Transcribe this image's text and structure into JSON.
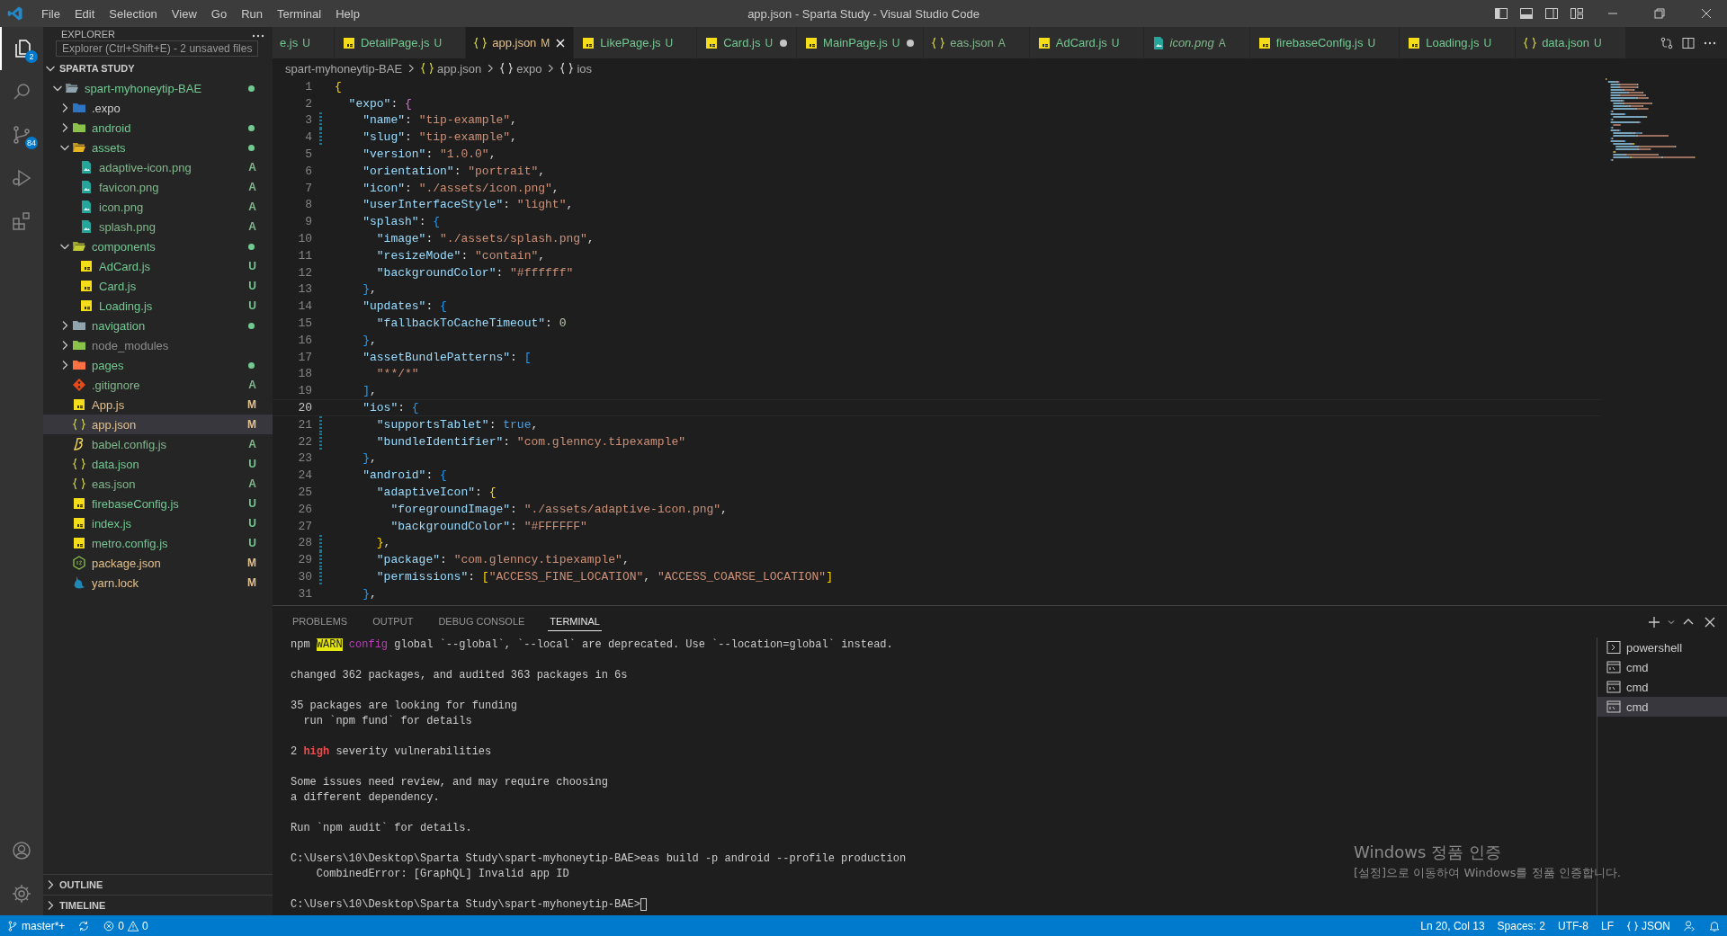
{
  "window": {
    "title": "app.json - Sparta Study - Visual Studio Code"
  },
  "menu": [
    "File",
    "Edit",
    "Selection",
    "View",
    "Go",
    "Run",
    "Terminal",
    "Help"
  ],
  "activity_bar": {
    "top": [
      {
        "badge": "2",
        "selected": true
      },
      {
        "selected": false
      },
      {
        "badge": "84",
        "selected": false
      },
      {
        "selected": false
      },
      {
        "selected": false
      }
    ],
    "bottom": [
      {
        "selected": false
      },
      {
        "selected": false
      }
    ]
  },
  "explorer": {
    "title": "EXPLORER",
    "tooltip": "Explorer (Ctrl+Shift+E) - 2 unsaved files",
    "workspace": "SPARTA STUDY",
    "tree": [
      {
        "kind": "folder",
        "name": "spart-myhoneytip-BAE",
        "color": "#73c991",
        "dot": true,
        "expanded": true,
        "selected": false,
        "children": [
          {
            "kind": "expo-folder",
            "name": ".expo",
            "color": "#cccccc",
            "dot": false,
            "expanded": false,
            "selected": false
          },
          {
            "kind": "android-folder",
            "name": "android",
            "color": "#73c991",
            "dot": true,
            "expanded": false,
            "selected": false
          },
          {
            "kind": "assets-folder",
            "name": "assets",
            "color": "#73c991",
            "dot": true,
            "expanded": true,
            "selected": false,
            "children": [
              {
                "kind": "image",
                "name": "adaptive-icon.png",
                "badge": "A",
                "color": "#81b88b",
                "dot": false,
                "selected": false
              },
              {
                "kind": "image",
                "name": "favicon.png",
                "badge": "A",
                "color": "#81b88b",
                "dot": false,
                "selected": false
              },
              {
                "kind": "image",
                "name": "icon.png",
                "badge": "A",
                "color": "#81b88b",
                "dot": false,
                "selected": false
              },
              {
                "kind": "image",
                "name": "splash.png",
                "badge": "A",
                "color": "#81b88b",
                "dot": false,
                "selected": false
              }
            ]
          },
          {
            "kind": "components-folder",
            "name": "components",
            "color": "#73c991",
            "dot": true,
            "expanded": true,
            "selected": false,
            "children": [
              {
                "kind": "js",
                "name": "AdCard.js",
                "badge": "U",
                "color": "#73c991",
                "dot": false,
                "selected": false
              },
              {
                "kind": "js",
                "name": "Card.js",
                "badge": "U",
                "color": "#73c991",
                "dot": false,
                "selected": false
              },
              {
                "kind": "js",
                "name": "Loading.js",
                "badge": "U",
                "color": "#73c991",
                "dot": false,
                "selected": false
              }
            ]
          },
          {
            "kind": "folder",
            "name": "navigation",
            "color": "#73c991",
            "dot": true,
            "expanded": false,
            "selected": false
          },
          {
            "kind": "node-folder",
            "name": "node_modules",
            "color": "#8c8c8c",
            "dot": false,
            "expanded": false,
            "selected": false
          },
          {
            "kind": "pages-folder",
            "name": "pages",
            "color": "#73c991",
            "dot": true,
            "expanded": false,
            "selected": false
          },
          {
            "kind": "git",
            "name": ".gitignore",
            "badge": "A",
            "color": "#81b88b",
            "dot": false,
            "selected": false
          },
          {
            "kind": "js",
            "name": "App.js",
            "badge": "M",
            "color": "#e2c08d",
            "dot": false,
            "selected": false
          },
          {
            "kind": "json",
            "name": "app.json",
            "badge": "M",
            "color": "#e2c08d",
            "dot": false,
            "selected": true
          },
          {
            "kind": "babel",
            "name": "babel.config.js",
            "badge": "A",
            "color": "#81b88b",
            "dot": false,
            "selected": false
          },
          {
            "kind": "json",
            "name": "data.json",
            "badge": "U",
            "color": "#73c991",
            "dot": false,
            "selected": false
          },
          {
            "kind": "json",
            "name": "eas.json",
            "badge": "A",
            "color": "#81b88b",
            "dot": false,
            "selected": false
          },
          {
            "kind": "js",
            "name": "firebaseConfig.js",
            "badge": "U",
            "color": "#73c991",
            "dot": false,
            "selected": false
          },
          {
            "kind": "js",
            "name": "index.js",
            "badge": "U",
            "color": "#73c991",
            "dot": false,
            "selected": false
          },
          {
            "kind": "js",
            "name": "metro.config.js",
            "badge": "U",
            "color": "#73c991",
            "dot": false,
            "selected": false
          },
          {
            "kind": "node",
            "name": "package.json",
            "badge": "M",
            "color": "#e2c08d",
            "dot": false,
            "selected": false
          },
          {
            "kind": "yarn",
            "name": "yarn.lock",
            "badge": "M",
            "color": "#e2c08d",
            "dot": false,
            "selected": false
          }
        ]
      }
    ],
    "sections": [
      {
        "title": "OUTLINE",
        "expanded": false
      },
      {
        "title": "TIMELINE",
        "expanded": false
      }
    ]
  },
  "tabs": [
    {
      "label": "e.js",
      "status": "U",
      "color": "#73c991",
      "dirty": false,
      "selected": false,
      "preview": false
    },
    {
      "kind": "js",
      "label": "DetailPage.js",
      "status": "U",
      "color": "#73c991",
      "dirty": false,
      "selected": false,
      "preview": false
    },
    {
      "kind": "json",
      "label": "app.json",
      "status": "M",
      "color": "#e2c08d",
      "dirty": false,
      "selected": true,
      "preview": false
    },
    {
      "kind": "js",
      "label": "LikePage.js",
      "status": "U",
      "color": "#73c991",
      "dirty": false,
      "selected": false,
      "preview": false
    },
    {
      "kind": "js",
      "label": "Card.js",
      "status": "U",
      "color": "#73c991",
      "dirty": true,
      "selected": false,
      "preview": false
    },
    {
      "kind": "js",
      "label": "MainPage.js",
      "status": "U",
      "color": "#73c991",
      "dirty": true,
      "selected": false,
      "preview": false
    },
    {
      "kind": "json",
      "label": "eas.json",
      "status": "A",
      "color": "#81b88b",
      "dirty": false,
      "selected": false,
      "preview": false
    },
    {
      "kind": "js",
      "label": "AdCard.js",
      "status": "U",
      "color": "#73c991",
      "dirty": false,
      "selected": false,
      "preview": false
    },
    {
      "kind": "image",
      "label": "icon.png",
      "status": "A",
      "color": "#81b88b",
      "dirty": false,
      "selected": false,
      "preview": true
    },
    {
      "kind": "js",
      "label": "firebaseConfig.js",
      "status": "U",
      "color": "#73c991",
      "dirty": false,
      "selected": false,
      "preview": false
    },
    {
      "kind": "js",
      "label": "Loading.js",
      "status": "U",
      "color": "#73c991",
      "dirty": false,
      "selected": false,
      "preview": false
    },
    {
      "kind": "json",
      "label": "data.json",
      "status": "U",
      "color": "#73c991",
      "dirty": false,
      "selected": false,
      "preview": false
    }
  ],
  "breadcrumb": [
    {
      "text": "spart-myhoneytip-BAE"
    },
    {
      "kind": "json",
      "text": "app.json"
    },
    {
      "kind": "object",
      "text": "expo"
    },
    {
      "kind": "object",
      "text": "ios"
    }
  ],
  "editor": {
    "lines": [
      {
        "number": "1",
        "current": false,
        "changed": false,
        "tokens": [
          {
            "kind": "b1",
            "text": "{"
          }
        ]
      },
      {
        "number": "2",
        "current": false,
        "changed": false,
        "tokens": [
          {
            "kind": "key",
            "text": "  \"expo\""
          },
          {
            "kind": "punct",
            "text": ": "
          },
          {
            "kind": "b2",
            "text": "{"
          }
        ]
      },
      {
        "number": "3",
        "current": false,
        "changed": true,
        "tokens": [
          {
            "kind": "key",
            "text": "    \"name\""
          },
          {
            "kind": "punct",
            "text": ": "
          },
          {
            "kind": "string",
            "text": "\"tip-example\""
          },
          {
            "kind": "punct",
            "text": ","
          }
        ]
      },
      {
        "number": "4",
        "current": false,
        "changed": true,
        "tokens": [
          {
            "kind": "key",
            "text": "    \"slug\""
          },
          {
            "kind": "punct",
            "text": ": "
          },
          {
            "kind": "string",
            "text": "\"tip-example\""
          },
          {
            "kind": "punct",
            "text": ","
          }
        ]
      },
      {
        "number": "5",
        "current": false,
        "changed": false,
        "tokens": [
          {
            "kind": "key",
            "text": "    \"version\""
          },
          {
            "kind": "punct",
            "text": ": "
          },
          {
            "kind": "string",
            "text": "\"1.0.0\""
          },
          {
            "kind": "punct",
            "text": ","
          }
        ]
      },
      {
        "number": "6",
        "current": false,
        "changed": false,
        "tokens": [
          {
            "kind": "key",
            "text": "    \"orientation\""
          },
          {
            "kind": "punct",
            "text": ": "
          },
          {
            "kind": "string",
            "text": "\"portrait\""
          },
          {
            "kind": "punct",
            "text": ","
          }
        ]
      },
      {
        "number": "7",
        "current": false,
        "changed": false,
        "tokens": [
          {
            "kind": "key",
            "text": "    \"icon\""
          },
          {
            "kind": "punct",
            "text": ": "
          },
          {
            "kind": "string",
            "text": "\"./assets/icon.png\""
          },
          {
            "kind": "punct",
            "text": ","
          }
        ]
      },
      {
        "number": "8",
        "current": false,
        "changed": false,
        "tokens": [
          {
            "kind": "key",
            "text": "    \"userInterfaceStyle\""
          },
          {
            "kind": "punct",
            "text": ": "
          },
          {
            "kind": "string",
            "text": "\"light\""
          },
          {
            "kind": "punct",
            "text": ","
          }
        ]
      },
      {
        "number": "9",
        "current": false,
        "changed": false,
        "tokens": [
          {
            "kind": "key",
            "text": "    \"splash\""
          },
          {
            "kind": "punct",
            "text": ": "
          },
          {
            "kind": "b3",
            "text": "{"
          }
        ]
      },
      {
        "number": "10",
        "current": false,
        "changed": false,
        "tokens": [
          {
            "kind": "key",
            "text": "      \"image\""
          },
          {
            "kind": "punct",
            "text": ": "
          },
          {
            "kind": "string",
            "text": "\"./assets/splash.png\""
          },
          {
            "kind": "punct",
            "text": ","
          }
        ]
      },
      {
        "number": "11",
        "current": false,
        "changed": false,
        "tokens": [
          {
            "kind": "key",
            "text": "      \"resizeMode\""
          },
          {
            "kind": "punct",
            "text": ": "
          },
          {
            "kind": "string",
            "text": "\"contain\""
          },
          {
            "kind": "punct",
            "text": ","
          }
        ]
      },
      {
        "number": "12",
        "current": false,
        "changed": false,
        "tokens": [
          {
            "kind": "key",
            "text": "      \"backgroundColor\""
          },
          {
            "kind": "punct",
            "text": ": "
          },
          {
            "kind": "string",
            "text": "\"#ffffff\""
          }
        ]
      },
      {
        "number": "13",
        "current": false,
        "changed": false,
        "tokens": [
          {
            "kind": "b3",
            "text": "    }"
          },
          {
            "kind": "punct",
            "text": ","
          }
        ]
      },
      {
        "number": "14",
        "current": false,
        "changed": false,
        "tokens": [
          {
            "kind": "key",
            "text": "    \"updates\""
          },
          {
            "kind": "punct",
            "text": ": "
          },
          {
            "kind": "b3",
            "text": "{"
          }
        ]
      },
      {
        "number": "15",
        "current": false,
        "changed": false,
        "tokens": [
          {
            "kind": "key",
            "text": "      \"fallbackToCacheTimeout\""
          },
          {
            "kind": "punct",
            "text": ": "
          },
          {
            "kind": "number",
            "text": "0"
          }
        ]
      },
      {
        "number": "16",
        "current": false,
        "changed": false,
        "tokens": [
          {
            "kind": "b3",
            "text": "    }"
          },
          {
            "kind": "punct",
            "text": ","
          }
        ]
      },
      {
        "number": "17",
        "current": false,
        "changed": false,
        "tokens": [
          {
            "kind": "key",
            "text": "    \"assetBundlePatterns\""
          },
          {
            "kind": "punct",
            "text": ": "
          },
          {
            "kind": "b3",
            "text": "["
          }
        ]
      },
      {
        "number": "18",
        "current": false,
        "changed": false,
        "tokens": [
          {
            "kind": "string",
            "text": "      \"**/*\""
          }
        ]
      },
      {
        "number": "19",
        "current": false,
        "changed": false,
        "tokens": [
          {
            "kind": "b3",
            "text": "    ]"
          },
          {
            "kind": "punct",
            "text": ","
          }
        ]
      },
      {
        "number": "20",
        "current": true,
        "changed": false,
        "tokens": [
          {
            "kind": "key",
            "text": "    \"ios\""
          },
          {
            "kind": "punct",
            "text": ": "
          },
          {
            "kind": "b3",
            "text": "{"
          }
        ]
      },
      {
        "number": "21",
        "current": false,
        "changed": true,
        "tokens": [
          {
            "kind": "key",
            "text": "      \"supportsTablet\""
          },
          {
            "kind": "punct",
            "text": ": "
          },
          {
            "kind": "bool",
            "text": "true"
          },
          {
            "kind": "punct",
            "text": ","
          }
        ]
      },
      {
        "number": "22",
        "current": false,
        "changed": true,
        "tokens": [
          {
            "kind": "key",
            "text": "      \"bundleIdentifier\""
          },
          {
            "kind": "punct",
            "text": ": "
          },
          {
            "kind": "string",
            "text": "\"com.glenncy.tipexample\""
          }
        ]
      },
      {
        "number": "23",
        "current": false,
        "changed": false,
        "tokens": [
          {
            "kind": "b3",
            "text": "    }"
          },
          {
            "kind": "punct",
            "text": ","
          }
        ]
      },
      {
        "number": "24",
        "current": false,
        "changed": false,
        "tokens": [
          {
            "kind": "key",
            "text": "    \"android\""
          },
          {
            "kind": "punct",
            "text": ": "
          },
          {
            "kind": "b3",
            "text": "{"
          }
        ]
      },
      {
        "number": "25",
        "current": false,
        "changed": false,
        "tokens": [
          {
            "kind": "key",
            "text": "      \"adaptiveIcon\""
          },
          {
            "kind": "punct",
            "text": ": "
          },
          {
            "kind": "b1",
            "text": "{"
          }
        ]
      },
      {
        "number": "26",
        "current": false,
        "changed": false,
        "tokens": [
          {
            "kind": "key",
            "text": "        \"foregroundImage\""
          },
          {
            "kind": "punct",
            "text": ": "
          },
          {
            "kind": "string",
            "text": "\"./assets/adaptive-icon.png\""
          },
          {
            "kind": "punct",
            "text": ","
          }
        ]
      },
      {
        "number": "27",
        "current": false,
        "changed": false,
        "tokens": [
          {
            "kind": "key",
            "text": "        \"backgroundColor\""
          },
          {
            "kind": "punct",
            "text": ": "
          },
          {
            "kind": "string",
            "text": "\"#FFFFFF\""
          }
        ]
      },
      {
        "number": "28",
        "current": false,
        "changed": true,
        "tokens": [
          {
            "kind": "b1",
            "text": "      }"
          },
          {
            "kind": "punct",
            "text": ","
          }
        ]
      },
      {
        "number": "29",
        "current": false,
        "changed": true,
        "tokens": [
          {
            "kind": "key",
            "text": "      \"package\""
          },
          {
            "kind": "punct",
            "text": ": "
          },
          {
            "kind": "string",
            "text": "\"com.glenncy.tipexample\""
          },
          {
            "kind": "punct",
            "text": ","
          }
        ]
      },
      {
        "number": "30",
        "current": false,
        "changed": true,
        "tokens": [
          {
            "kind": "key",
            "text": "      \"permissions\""
          },
          {
            "kind": "punct",
            "text": ": "
          },
          {
            "kind": "b1",
            "text": "["
          },
          {
            "kind": "string",
            "text": "\"ACCESS_FINE_LOCATION\""
          },
          {
            "kind": "punct",
            "text": ", "
          },
          {
            "kind": "string",
            "text": "\"ACCESS_COARSE_LOCATION\""
          },
          {
            "kind": "b1",
            "text": "]"
          }
        ]
      },
      {
        "number": "31",
        "current": false,
        "changed": false,
        "tokens": [
          {
            "kind": "b3",
            "text": "    }"
          },
          {
            "kind": "punct",
            "text": ","
          }
        ]
      }
    ]
  },
  "panel": {
    "tabs": [
      {
        "label": "PROBLEMS",
        "selected": false
      },
      {
        "label": "OUTPUT",
        "selected": false
      },
      {
        "label": "DEBUG CONSOLE",
        "selected": false
      },
      {
        "label": "TERMINAL",
        "selected": true
      }
    ],
    "terminal": {
      "cursor": true,
      "blocks": [
        [
          [
            {
              "kind": "plain",
              "text": "npm "
            },
            {
              "kind": "warn",
              "text": "WARN"
            },
            {
              "kind": "keyword",
              "text": " config"
            },
            {
              "kind": "plain",
              "text": " global `--global`, `--local` are deprecated. Use `--location=global` instead."
            }
          ]
        ],
        [
          [
            {
              "kind": "plain",
              "text": "changed 362 packages, and audited 363 packages in 6s"
            }
          ]
        ],
        [
          [
            {
              "kind": "plain",
              "text": "35 packages are looking for funding"
            }
          ],
          [
            {
              "kind": "plain",
              "text": "  run `npm fund` for details"
            }
          ]
        ],
        [
          [
            {
              "kind": "plain",
              "text": "2 "
            },
            {
              "kind": "error",
              "text": "high"
            },
            {
              "kind": "plain",
              "text": " severity vulnerabilities"
            }
          ]
        ],
        [
          [
            {
              "kind": "plain",
              "text": "Some issues need review, and may require choosing"
            }
          ],
          [
            {
              "kind": "plain",
              "text": "a different dependency."
            }
          ]
        ],
        [
          [
            {
              "kind": "plain",
              "text": "Run `npm audit` for details."
            }
          ]
        ],
        [
          [
            {
              "kind": "plain",
              "text": "C:\\Users\\10\\Desktop\\Sparta Study\\spart-myhoneytip-BAE>eas build -p android --profile production"
            }
          ],
          [
            {
              "kind": "plain",
              "text": "    CombinedError: [GraphQL] Invalid app ID"
            }
          ]
        ],
        [
          [
            {
              "kind": "plain",
              "text": "C:\\Users\\10\\Desktop\\Sparta Study\\spart-myhoneytip-BAE>"
            }
          ]
        ]
      ]
    },
    "terminals": [
      {
        "kind": "powershell",
        "name": "powershell",
        "selected": false
      },
      {
        "kind": "cmd",
        "name": "cmd",
        "selected": false
      },
      {
        "kind": "cmd",
        "name": "cmd",
        "selected": false
      },
      {
        "kind": "cmd",
        "name": "cmd",
        "selected": true
      }
    ]
  },
  "activation_notice": {
    "title": "Windows 정품 인증",
    "message": "[설정]으로 이동하여 Windows를 정품 인증합니다."
  },
  "status_bar": {
    "branch": "master*+",
    "errors": "0",
    "warnings": "0",
    "position": "Ln 20, Col 13",
    "indentation": "Spaces: 2",
    "encoding": "UTF-8",
    "eol": "LF",
    "language": "JSON"
  }
}
